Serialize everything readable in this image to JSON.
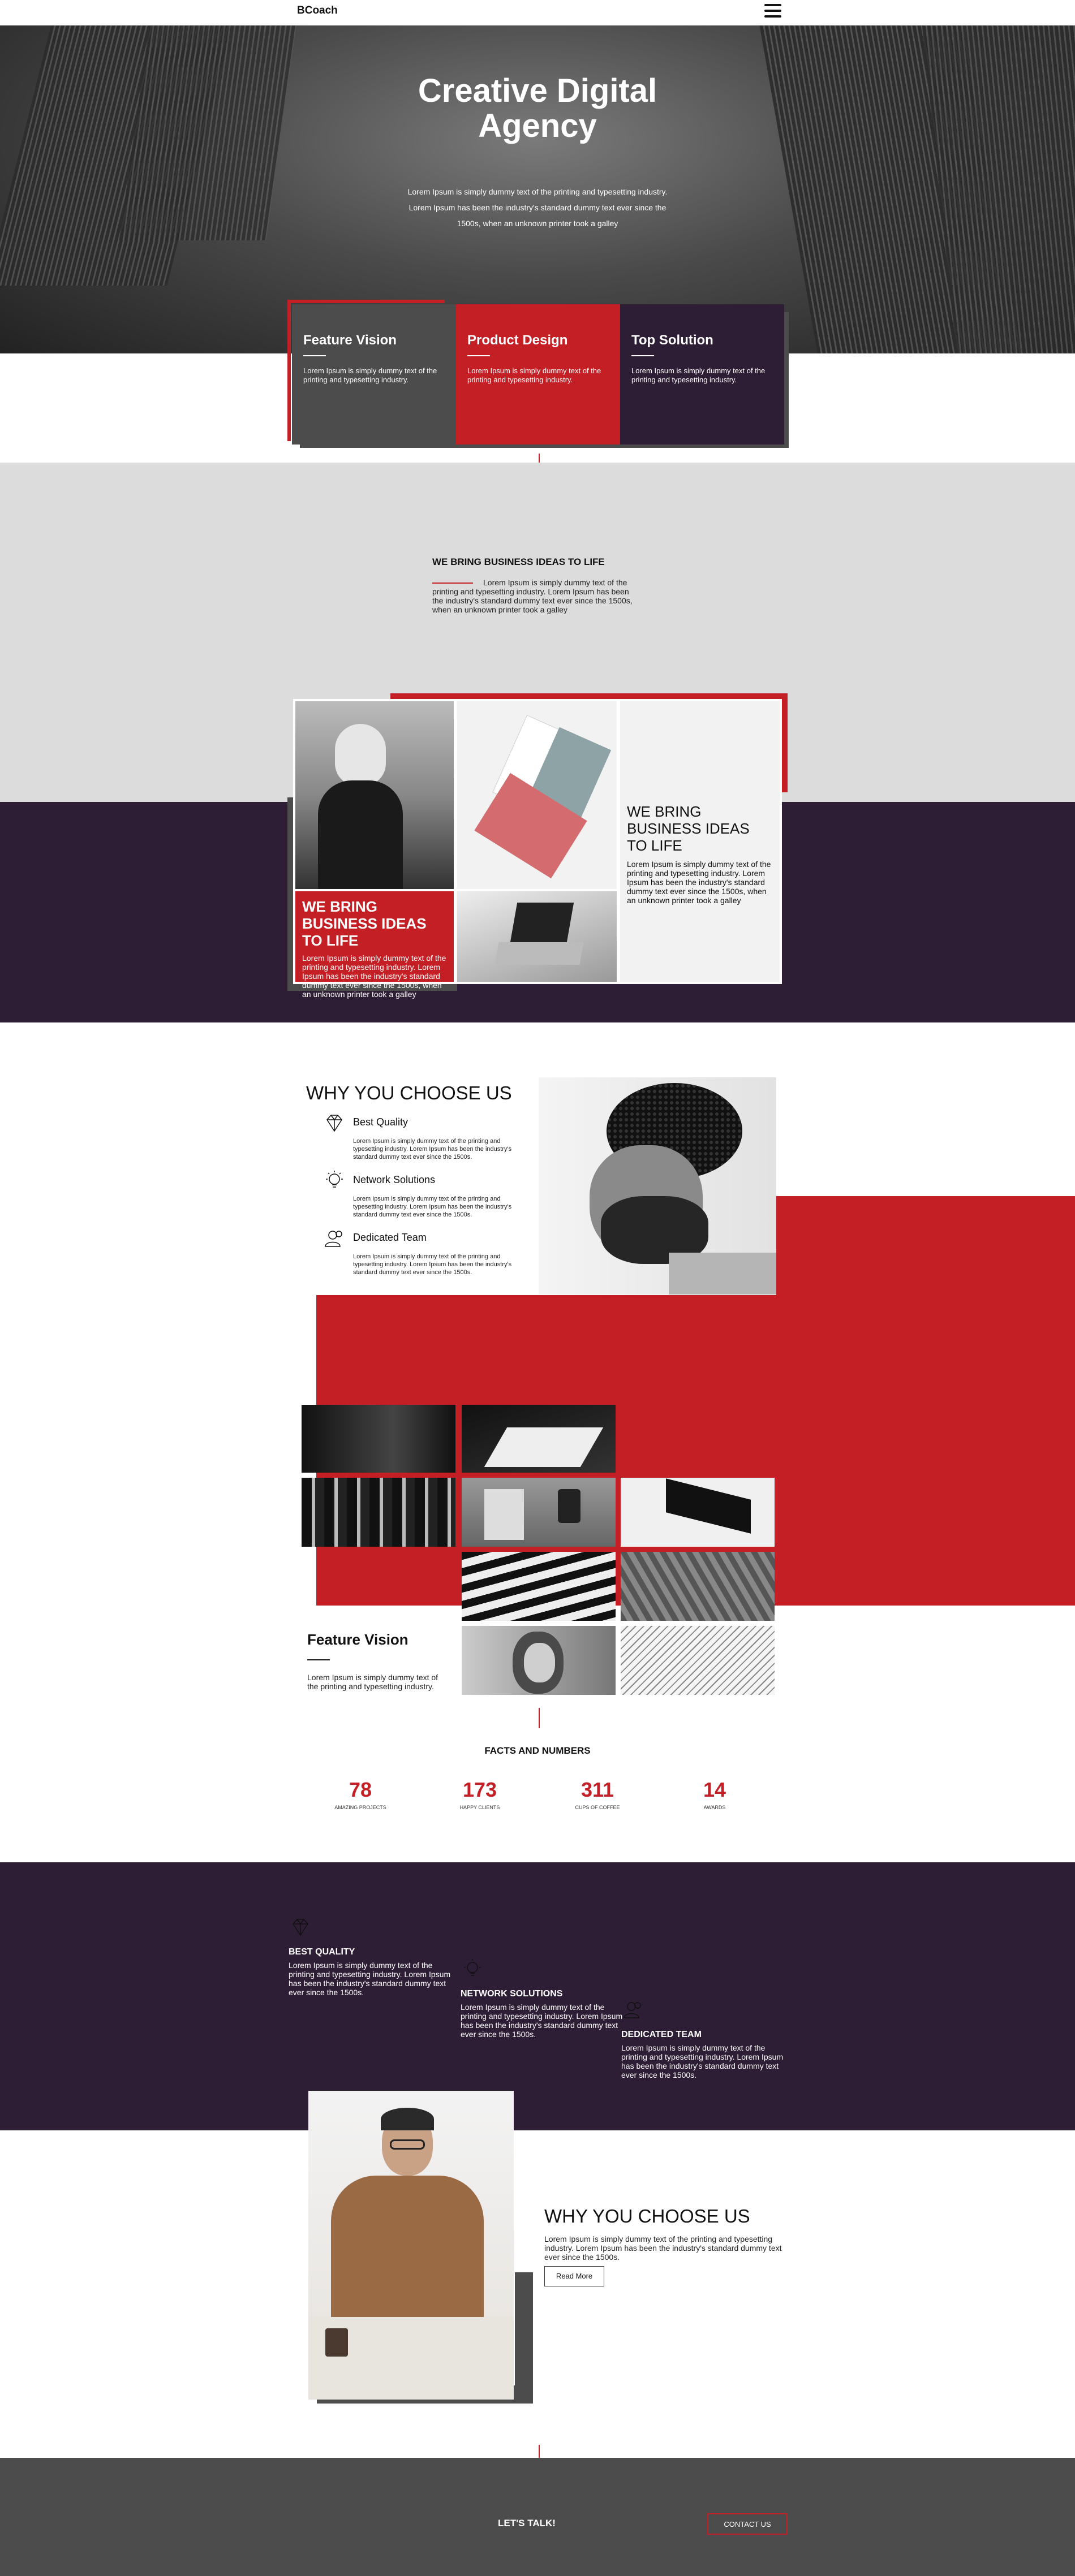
{
  "nav": {
    "brand": "BCoach",
    "menu_icon": "hamburger-menu-icon"
  },
  "hero": {
    "title": "Creative Digital Agency",
    "subtitle": "Lorem Ipsum is simply dummy text of the printing and typesetting industry. Lorem Ipsum has been the industry's standard dummy text ever since the 1500s, when an unknown printer took a galley"
  },
  "features": [
    {
      "title": "Feature Vision",
      "text": "Lorem Ipsum is simply dummy text of the printing and typesetting industry."
    },
    {
      "title": "Product Design",
      "text": "Lorem Ipsum is simply dummy text of the printing and typesetting industry."
    },
    {
      "title": "Top Solution",
      "text": "Lorem Ipsum is simply dummy text of the printing and typesetting industry."
    }
  ],
  "ideas": {
    "title": "WE BRING BUSINESS IDEAS TO LIFE",
    "text": "Lorem Ipsum is simply dummy text of the printing and typesetting industry. Lorem Ipsum has been the industry's standard dummy text ever since the 1500s, when an unknown printer took a galley"
  },
  "grid": {
    "red_title": "WE BRING BUSINESS IDEAS TO LIFE",
    "red_text": "Lorem Ipsum is simply dummy text of the printing and typesetting industry. Lorem Ipsum has been the industry's standard dummy text ever since the 1500s, when an unknown printer took a galley",
    "white_title": "WE BRING BUSINESS IDEAS TO LIFE",
    "white_text": "Lorem Ipsum is simply dummy text of the printing and typesetting industry. Lorem Ipsum has been the industry's standard dummy text ever since the 1500s, when an unknown printer took a galley"
  },
  "why": {
    "title": "WHY YOU CHOOSE US",
    "items": [
      {
        "title": "Best Quality",
        "text": "Lorem Ipsum is simply dummy text of the printing and typesetting industry. Lorem Ipsum has been the industry's standard dummy text ever since the 1500s.",
        "icon": "diamond-icon"
      },
      {
        "title": "Network Solutions",
        "text": "Lorem Ipsum is simply dummy text of the printing and typesetting industry. Lorem Ipsum has been the industry's standard dummy text ever since the 1500s.",
        "icon": "lightbulb-icon"
      },
      {
        "title": "Dedicated Team",
        "text": "Lorem Ipsum is simply dummy text of the printing and typesetting industry. Lorem Ipsum has been the industry's standard dummy text ever since the 1500s.",
        "icon": "team-icon"
      }
    ]
  },
  "feature_vision": {
    "title": "Feature Vision",
    "text": "Lorem Ipsum is simply dummy text of the printing and typesetting industry."
  },
  "facts": {
    "title": "FACTS AND NUMBERS",
    "items": [
      {
        "num": "78",
        "label": "AMAZING PROJECTS"
      },
      {
        "num": "173",
        "label": "HAPPY CLIENTS"
      },
      {
        "num": "311",
        "label": "CUPS OF COFFEE"
      },
      {
        "num": "14",
        "label": "AWARDS"
      }
    ]
  },
  "services": [
    {
      "title": "BEST QUALITY",
      "text": "Lorem Ipsum is simply dummy text of the printing and typesetting industry. Lorem Ipsum has been the industry's standard dummy text ever since the 1500s."
    },
    {
      "title": "NETWORK SOLUTIONS",
      "text": "Lorem Ipsum is simply dummy text of the printing and typesetting industry. Lorem Ipsum has been the industry's standard dummy text ever since the 1500s."
    },
    {
      "title": "DEDICATED TEAM",
      "text": "Lorem Ipsum is simply dummy text of the printing and typesetting industry. Lorem Ipsum has been the industry's standard dummy text ever since the 1500s."
    }
  ],
  "why2": {
    "title": "WHY YOU CHOOSE US",
    "text": "Lorem Ipsum is simply dummy text of the printing and typesetting industry. Lorem Ipsum has been the industry's standard dummy text ever since the 1500s.",
    "button": "Read More"
  },
  "footer": {
    "talk": "LET'S TALK!",
    "contact": "CONTACT US"
  },
  "colors": {
    "accent": "#c41f25",
    "purple": "#2e1e35",
    "grey": "#4c4c4c",
    "light": "#dcdcdc"
  }
}
